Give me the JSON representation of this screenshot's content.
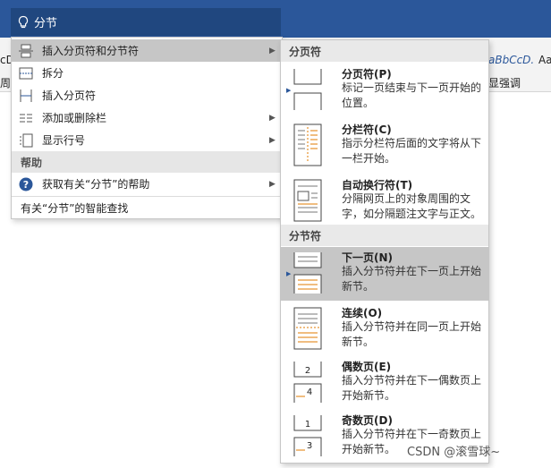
{
  "colors": {
    "accent": "#2b579a",
    "highlight": "#c6c6c6",
    "section": "#e6e6e6"
  },
  "ribbon": {
    "frag_left_1": "cD",
    "frag_left_2": "周",
    "frag_style_1": "aBbCcD.",
    "frag_style_2": "Aa",
    "frag_style_3": "显强调"
  },
  "search": {
    "icon": "lightbulb-icon",
    "text": "分节"
  },
  "menu": {
    "items": [
      {
        "label": "插入分页符和分节符",
        "icon": "page-break-icon",
        "has_submenu": true,
        "highlighted": true
      },
      {
        "label": "拆分",
        "icon": "split-icon",
        "has_submenu": false
      },
      {
        "label": "插入分页符",
        "icon": "insert-break-icon",
        "has_submenu": false
      },
      {
        "label": "添加或删除栏",
        "icon": "columns-icon",
        "has_submenu": true
      },
      {
        "label": "显示行号",
        "icon": "line-numbers-icon",
        "has_submenu": true
      }
    ],
    "help_section": "帮助",
    "help_item": {
      "label": "获取有关“分节”的帮助",
      "icon": "help-icon",
      "has_submenu": true
    },
    "smart_lookup": "有关“分节”的智能查找"
  },
  "flyout": {
    "page_breaks_header": "分页符",
    "section_breaks_header": "分节符",
    "page_breaks": [
      {
        "title": "分页符(P)",
        "desc": "标记一页结束与下一页开始的位置。",
        "icon": "page-break-thumb-icon"
      },
      {
        "title": "分栏符(C)",
        "desc": "指示分栏符后面的文字将从下一栏开始。",
        "icon": "column-break-thumb-icon"
      },
      {
        "title": "自动换行符(T)",
        "desc": "分隔网页上的对象周围的文字，如分隔题注文字与正文。",
        "icon": "text-wrap-thumb-icon"
      }
    ],
    "section_breaks": [
      {
        "title": "下一页(N)",
        "desc": "插入分节符并在下一页上开始新节。",
        "icon": "next-page-thumb-icon",
        "highlighted": true
      },
      {
        "title": "连续(O)",
        "desc": "插入分节符并在同一页上开始新节。",
        "icon": "continuous-thumb-icon"
      },
      {
        "title": "偶数页(E)",
        "desc": "插入分节符并在下一偶数页上开始新节。",
        "icon": "even-page-thumb-icon",
        "num_a": "2",
        "num_b": "4"
      },
      {
        "title": "奇数页(D)",
        "desc": "插入分节符并在下一奇数页上开始新节。",
        "icon": "odd-page-thumb-icon",
        "num_a": "1",
        "num_b": "3"
      }
    ]
  },
  "watermark": "CSDN @滚雪球~"
}
